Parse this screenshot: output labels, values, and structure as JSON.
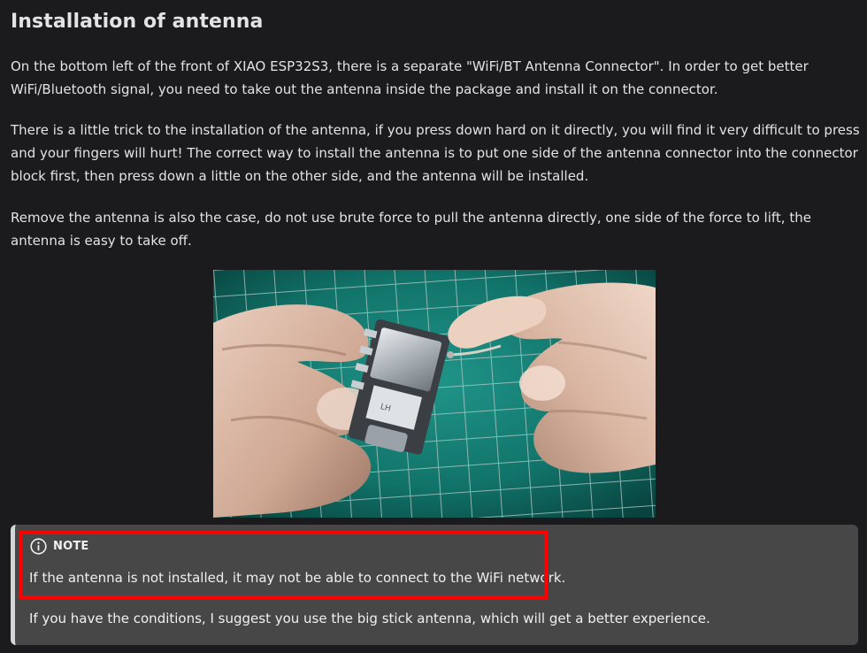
{
  "section": {
    "title": "Installation of antenna",
    "paragraphs": [
      "On the bottom left of the front of XIAO ESP32S3, there is a separate \"WiFi/BT Antenna Connector\". In order to get better WiFi/Bluetooth signal, you need to take out the antenna inside the package and install it on the connector.",
      "There is a little trick to the installation of the antenna, if you press down hard on it directly, you will find it very difficult to press and your fingers will hurt! The correct way to install the antenna is to put one side of the antenna connector into the connector block first, then press down a little on the other side, and the antenna will be installed.",
      "Remove the antenna is also the case, do not use brute force to pull the antenna directly, one side of the force to lift, the antenna is easy to take off."
    ]
  },
  "figure": {
    "icon": "photo-of-antenna-installation"
  },
  "note": {
    "label": "NOTE",
    "icon": "info-icon",
    "lines": [
      "If the antenna is not installed, it may not be able to connect to the WiFi network.",
      "If you have the conditions, I suggest you use the big stick antenna, which will get a better experience."
    ]
  },
  "colors": {
    "background": "#1b1b1d",
    "text": "#e3e3e3",
    "note_background": "#474748",
    "note_border": "#d4d5d8",
    "highlight": "#ff0000",
    "mat": "#0f6e67"
  }
}
